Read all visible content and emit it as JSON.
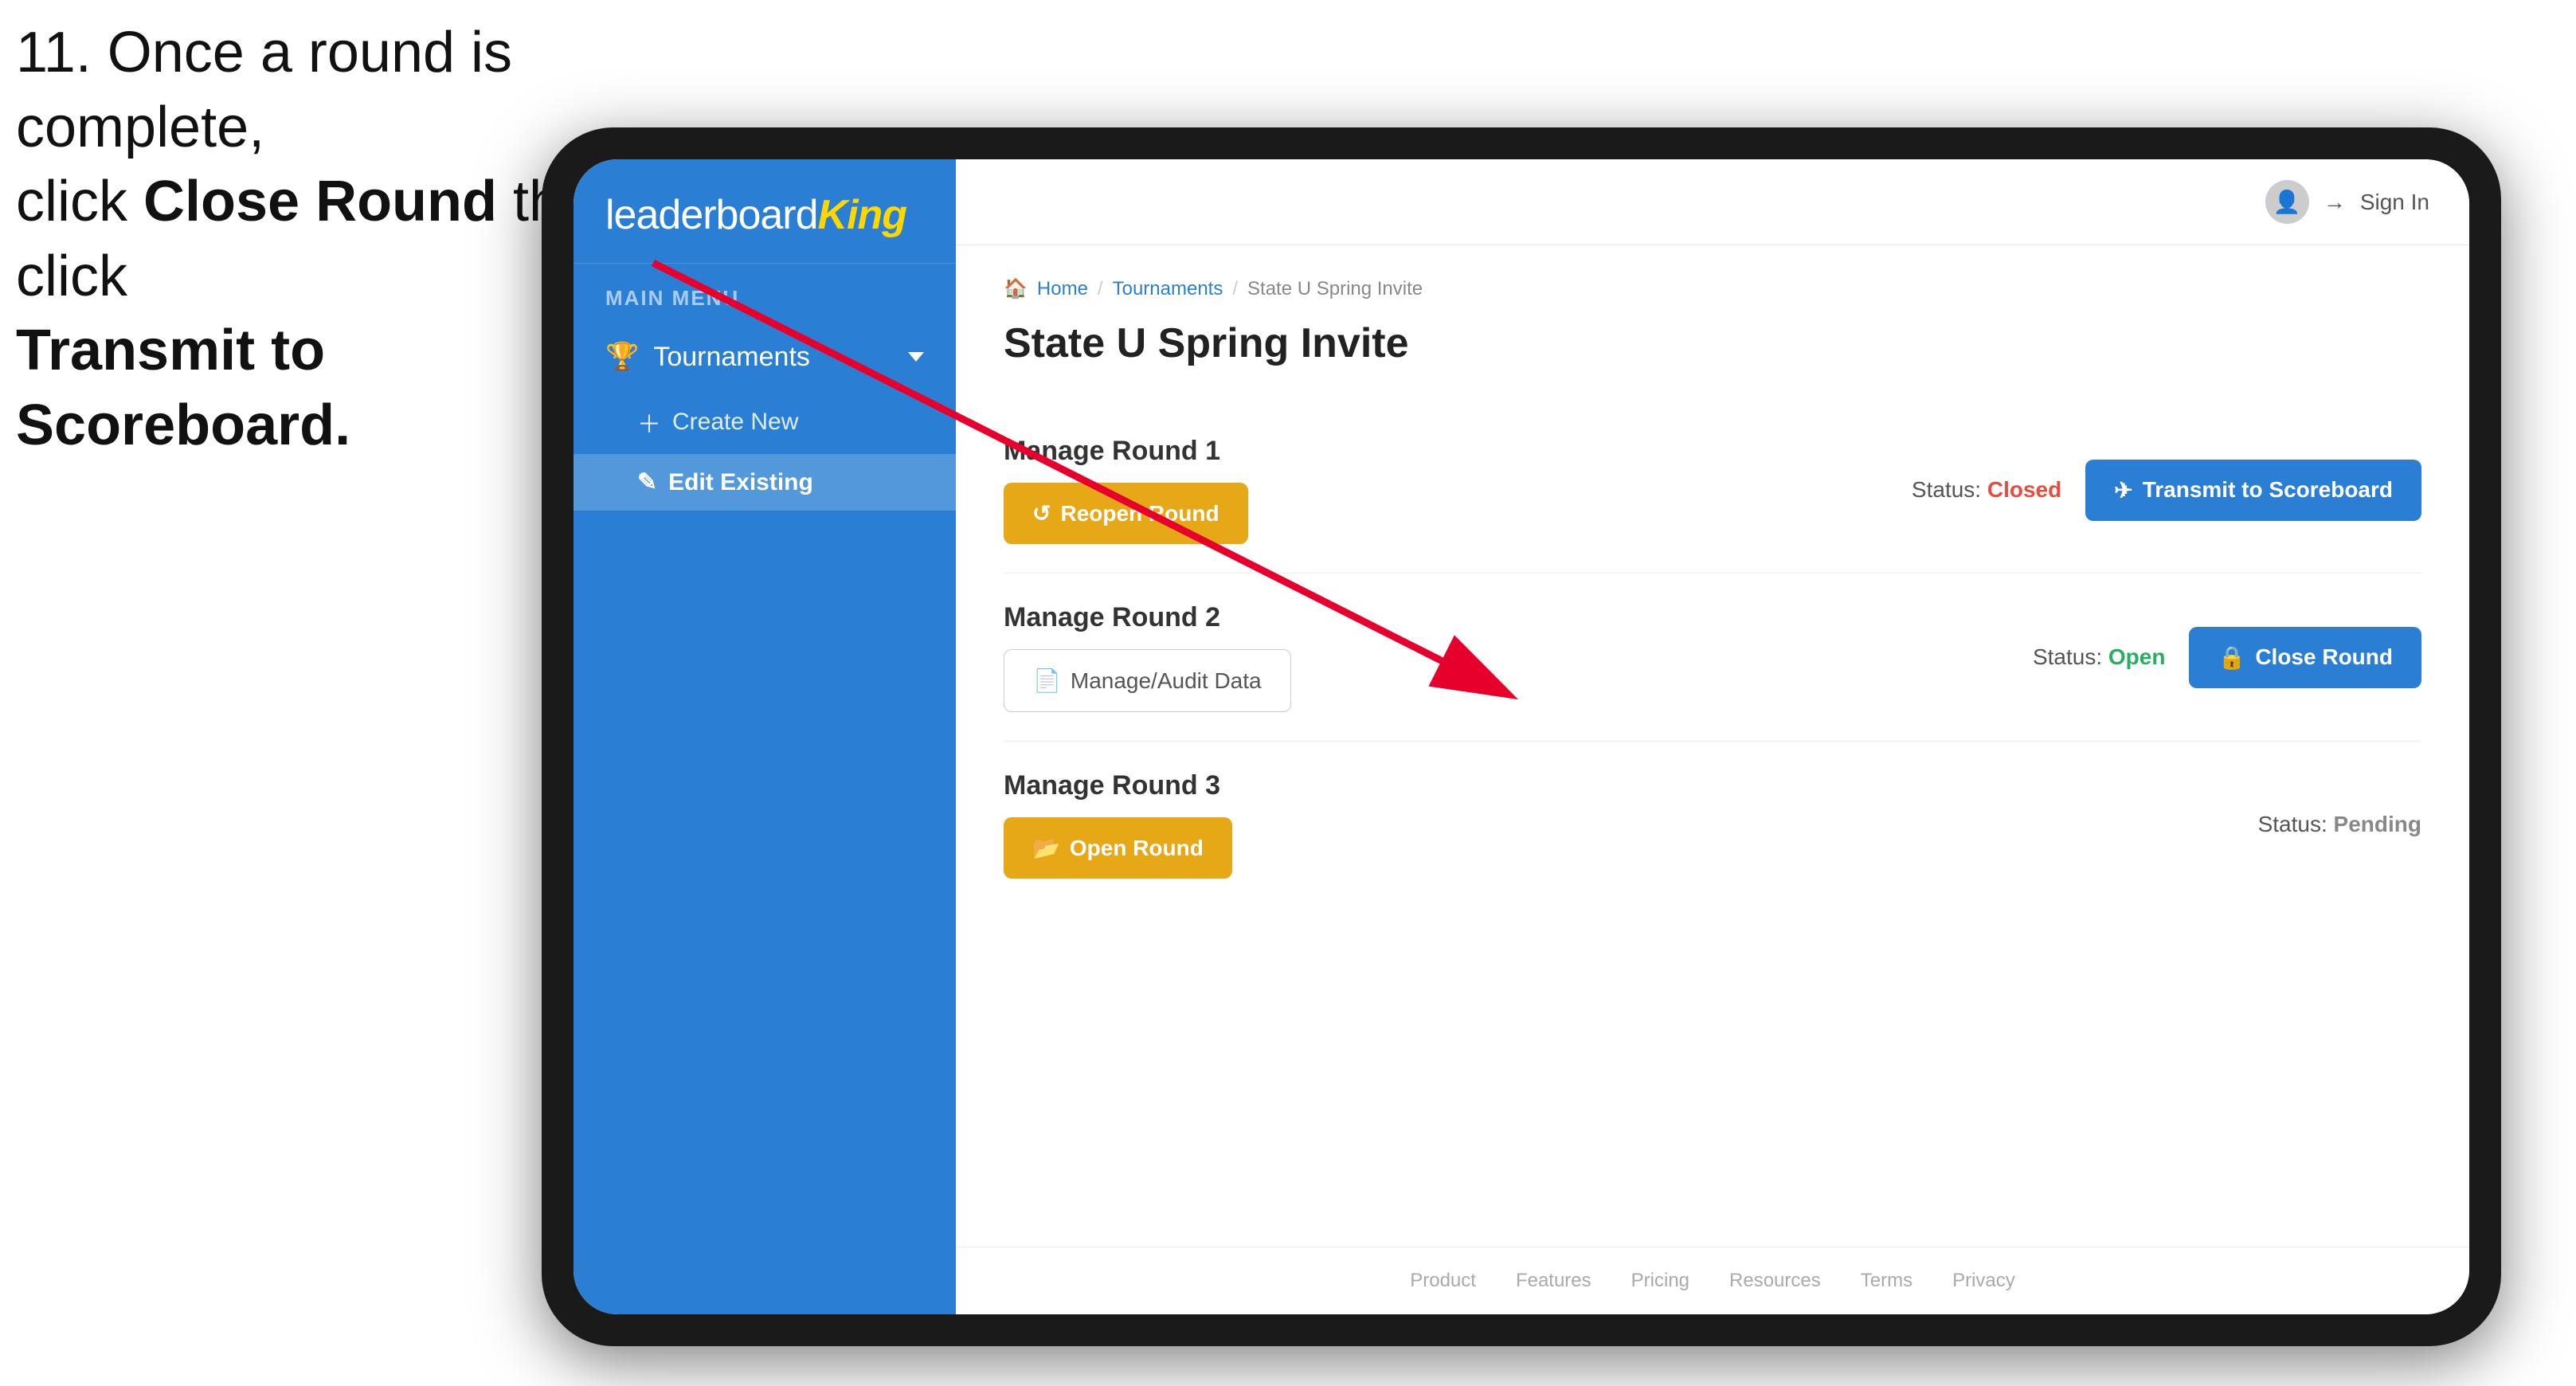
{
  "instruction": {
    "line1": "11. Once a round is complete,",
    "line2_prefix": "click ",
    "line2_bold": "Close Round",
    "line2_suffix": " then click",
    "line3_bold": "Transmit to Scoreboard."
  },
  "app": {
    "logo_text": "leaderboard",
    "logo_king": "King",
    "header": {
      "sign_in_label": "Sign In"
    },
    "sidebar": {
      "main_menu_label": "MAIN MENU",
      "nav_items": [
        {
          "label": "Tournaments",
          "icon": "trophy"
        }
      ],
      "sub_items": [
        {
          "label": "Create New",
          "icon": "plus"
        },
        {
          "label": "Edit Existing",
          "icon": "edit",
          "active": true
        }
      ]
    },
    "breadcrumb": {
      "home": "Home",
      "tournaments": "Tournaments",
      "current": "State U Spring Invite"
    },
    "page_title": "State U Spring Invite",
    "rounds": [
      {
        "title": "Manage Round 1",
        "status_label": "Status:",
        "status": "Closed",
        "status_class": "status-closed",
        "buttons": [
          {
            "label": "Reopen Round",
            "style": "gold",
            "icon": "refresh"
          }
        ],
        "right_buttons": [
          {
            "label": "Transmit to Scoreboard",
            "style": "blue",
            "icon": "send"
          }
        ]
      },
      {
        "title": "Manage Round 2",
        "status_label": "Status:",
        "status": "Open",
        "status_class": "status-open",
        "buttons": [
          {
            "label": "Manage/Audit Data",
            "style": "gray",
            "icon": "doc"
          }
        ],
        "right_buttons": [
          {
            "label": "Close Round",
            "style": "blue",
            "icon": "lock"
          }
        ]
      },
      {
        "title": "Manage Round 3",
        "status_label": "Status:",
        "status": "Pending",
        "status_class": "status-pending",
        "buttons": [
          {
            "label": "Open Round",
            "style": "gold",
            "icon": "folder"
          }
        ],
        "right_buttons": []
      }
    ],
    "footer": {
      "links": [
        "Product",
        "Features",
        "Pricing",
        "Resources",
        "Terms",
        "Privacy"
      ]
    }
  }
}
